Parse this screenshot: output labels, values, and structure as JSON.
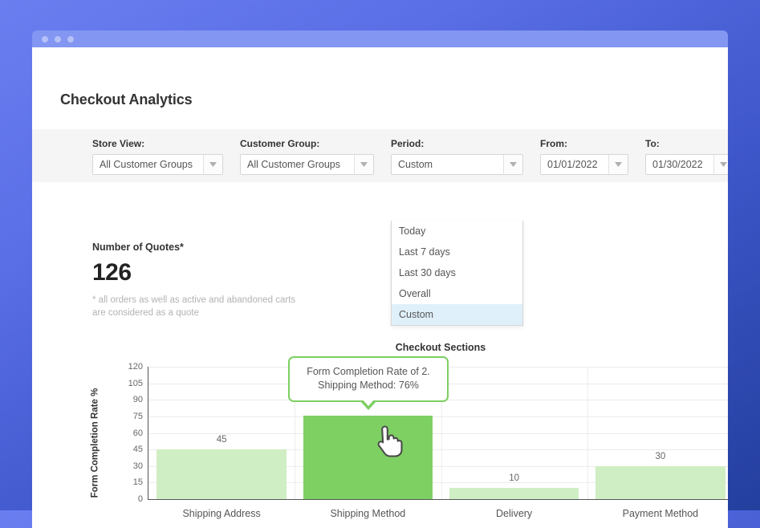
{
  "window": {
    "dots": [
      "close-dot",
      "minimize-dot",
      "maximize-dot"
    ]
  },
  "page": {
    "title": "Checkout Analytics"
  },
  "filters": [
    {
      "name": "store-view",
      "label": "Store View:",
      "value": "All Customer Groups",
      "options": []
    },
    {
      "name": "customer-group",
      "label": "Customer Group:",
      "value": "All Customer Groups",
      "options": []
    },
    {
      "name": "period",
      "label": "Period:",
      "value": "Custom",
      "open": true,
      "options": [
        "Today",
        "Last 7 days",
        "Last 30 days",
        "Overall",
        "Custom"
      ],
      "selected_option": "Custom"
    },
    {
      "name": "from-date",
      "label": "From:",
      "value": "01/01/2022",
      "options": []
    },
    {
      "name": "to-date",
      "label": "To:",
      "value": "01/30/2022",
      "options": []
    }
  ],
  "kpi": {
    "label": "Number of Quotes*",
    "value": "126",
    "note": "* all orders as well as active and abandoned carts are considered as a quote"
  },
  "tooltip": {
    "line1": "Form Completion Rate of 2.",
    "line2": "Shipping Method: 76%"
  },
  "colors": {
    "bar": "#d0eec4",
    "bar_hovered": "#7ed063",
    "tooltip_border": "#7dcf62",
    "filter_bar_bg": "#f5f5f5",
    "titlebar": "#8396f2",
    "backdrop_from": "#6b7ef0",
    "backdrop_to": "#233f9e"
  },
  "chart_data": {
    "type": "bar",
    "title": "Checkout Sections",
    "xlabel": "",
    "ylabel": "Form Completion Rate %",
    "categories": [
      "Shipping Address",
      "Shipping Method",
      "Delivery",
      "Payment Method"
    ],
    "values": [
      45,
      76,
      10,
      30
    ],
    "value_labels": [
      "45",
      "",
      "10",
      "30"
    ],
    "highlighted_index": 1,
    "highlighted_value": 76,
    "ylim": [
      0,
      120
    ],
    "yticks": [
      0,
      15,
      30,
      45,
      60,
      75,
      90,
      105,
      120
    ],
    "ytick_labels": [
      "0",
      "15",
      "30",
      "45",
      "60",
      "75",
      "90",
      "105",
      "120"
    ],
    "grid": true,
    "legend": false
  }
}
